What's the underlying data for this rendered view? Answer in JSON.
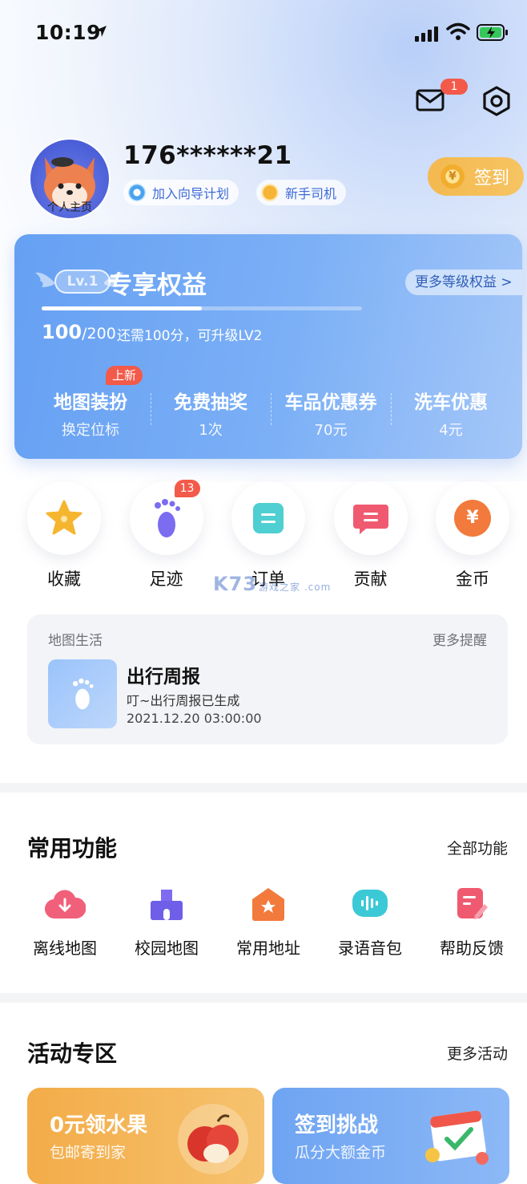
{
  "status_bar": {
    "time": "10:19"
  },
  "header": {
    "mail_badge": "1"
  },
  "profile": {
    "avatar_label": "个人主页",
    "phone": "176******21",
    "tags": [
      {
        "label": "加入向导计划"
      },
      {
        "label": "新手司机"
      }
    ],
    "checkin_label": "签到",
    "coin_symbol": "¥"
  },
  "level_card": {
    "level": "Lv.1",
    "title": "专享权益",
    "more_label": "更多等级权益 >",
    "score_current": "100",
    "score_max": "/200",
    "progress_fraction": 0.5,
    "score_note": "还需100分，可升级LV2",
    "new_badge": "上新",
    "perks": [
      {
        "title": "地图装扮",
        "sub": "换定位标"
      },
      {
        "title": "免费抽奖",
        "sub": "1次"
      },
      {
        "title": "车品优惠券",
        "sub": "70元"
      },
      {
        "title": "洗车优惠",
        "sub": "4元"
      }
    ]
  },
  "shortcuts": [
    {
      "label": "收藏",
      "icon": "star-icon"
    },
    {
      "label": "足迹",
      "icon": "footprint-icon",
      "badge": "13"
    },
    {
      "label": "订单",
      "icon": "order-icon"
    },
    {
      "label": "贡献",
      "icon": "contribution-icon"
    },
    {
      "label": "金币",
      "icon": "gold-coin-icon",
      "symbol": "¥"
    }
  ],
  "watermark": {
    "text": "K73",
    "sub": "游戏之家 .com"
  },
  "map_life": {
    "header": "地图生活",
    "more": "更多提醒",
    "title": "出行周报",
    "subtitle": "叮~出行周报已生成",
    "date": "2021.12.20 03:00:00"
  },
  "common_functions": {
    "title": "常用功能",
    "more": "全部功能",
    "items": [
      {
        "label": "离线地图",
        "icon": "cloud-download-icon"
      },
      {
        "label": "校园地图",
        "icon": "school-icon"
      },
      {
        "label": "常用地址",
        "icon": "home-star-icon"
      },
      {
        "label": "录语音包",
        "icon": "voice-wave-icon"
      },
      {
        "label": "帮助反馈",
        "icon": "feedback-edit-icon"
      }
    ]
  },
  "activities": {
    "title": "活动专区",
    "more": "更多活动",
    "cards": [
      {
        "title": "0元领水果",
        "sub": "包邮寄到家"
      },
      {
        "title": "签到挑战",
        "sub": "瓜分大额金币"
      }
    ]
  },
  "colors": {
    "accent_blue": "#6ea4f2",
    "badge_red": "#f35a4a",
    "checkin_orange": "#f4b94f"
  }
}
